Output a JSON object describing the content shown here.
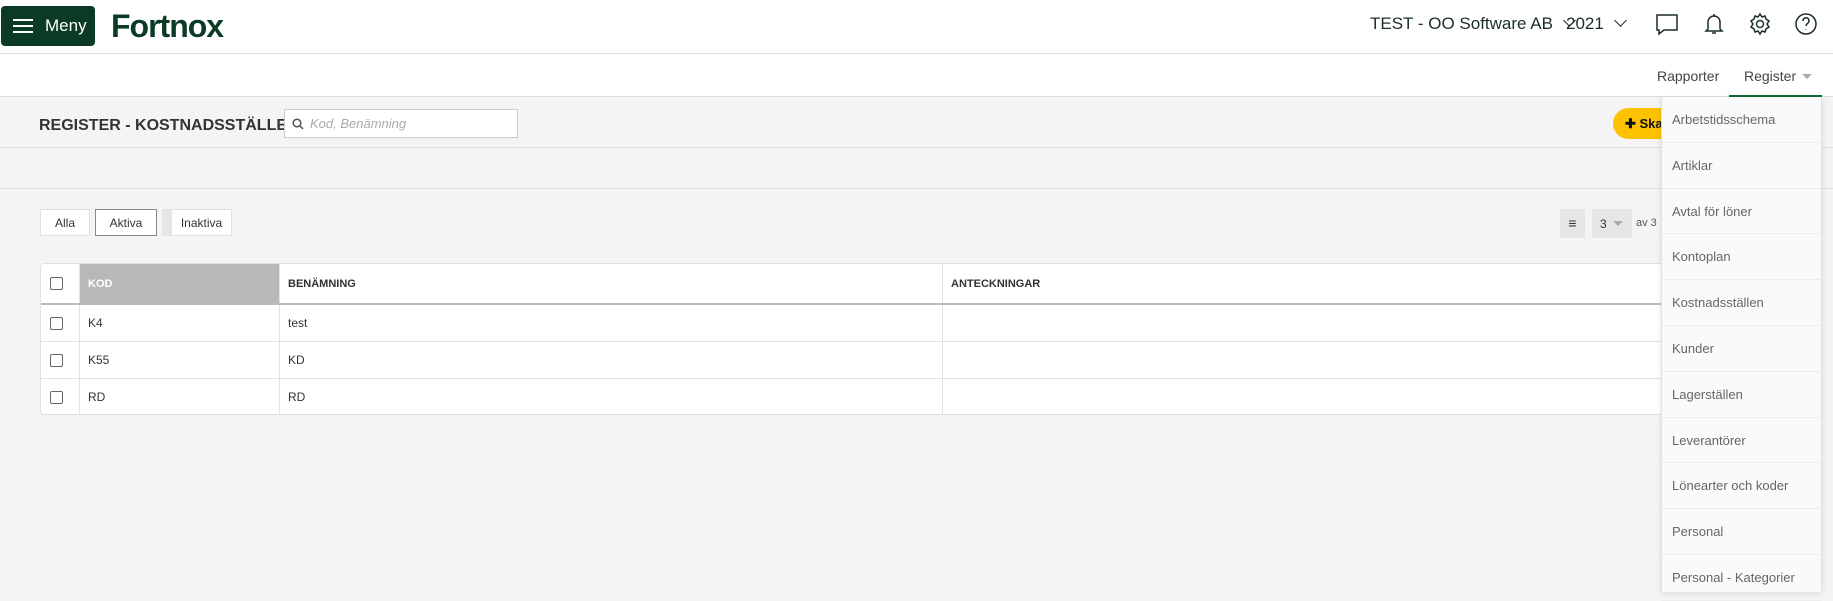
{
  "header": {
    "menu_label": "Meny",
    "logo": "Fortnox",
    "company": "TEST - OO Software AB",
    "year": "2021",
    "icons": [
      "chat-icon",
      "bell-icon",
      "gear-icon",
      "help-icon"
    ]
  },
  "subnav": {
    "items": [
      "Rapporter",
      "Register"
    ],
    "active": "Register"
  },
  "page": {
    "title": "REGISTER - KOSTNADSSTÄLLEN",
    "search_placeholder": "Kod, Benämning",
    "create_label": "Skapa",
    "accent": "#fcc200"
  },
  "filters": [
    "Alla",
    "Aktiva",
    "Inaktiva"
  ],
  "filter_selected": "Aktiva",
  "pagination": {
    "page": "3",
    "of": "av 3"
  },
  "table": {
    "columns": [
      "KOD",
      "BENÄMNING",
      "ANTECKNINGAR"
    ],
    "rows": [
      {
        "kod": "K4",
        "benamning": "test",
        "anteckningar": ""
      },
      {
        "kod": "K55",
        "benamning": "KD",
        "anteckningar": ""
      },
      {
        "kod": "RD",
        "benamning": "RD",
        "anteckningar": ""
      }
    ]
  },
  "dropdown": [
    "Arbetstidsschema",
    "Artiklar",
    "Avtal för löner",
    "Kontoplan",
    "Kostnadsställen",
    "Kunder",
    "Lagerställen",
    "Leverantörer",
    "Lönearter och koder",
    "Personal",
    "Personal - Kategorier"
  ],
  "colors": {
    "brand": "#0b3b24",
    "active_tab": "#0b6b35"
  }
}
